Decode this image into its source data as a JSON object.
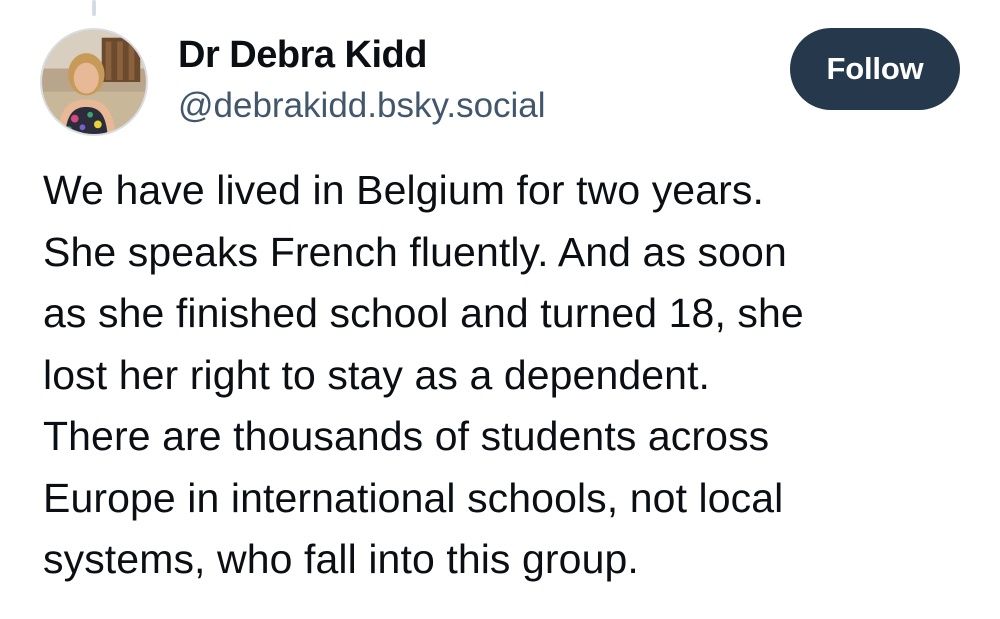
{
  "author": {
    "display_name": "Dr Debra Kidd",
    "handle": "@debrakidd.bsky.social"
  },
  "follow_button": {
    "label": "Follow"
  },
  "post": {
    "lines": [
      "We have lived in Belgium for two years.",
      "She speaks French fluently. And as soon",
      "as she finished school and turned 18, she",
      "lost her right to stay as a dependent.",
      "There are thousands of students across",
      "Europe in international schools, not local",
      "systems, who fall into this group."
    ]
  },
  "colors": {
    "follow_button_bg": "#26384b",
    "handle_text": "#42576c",
    "body_text": "#0b0f14"
  }
}
